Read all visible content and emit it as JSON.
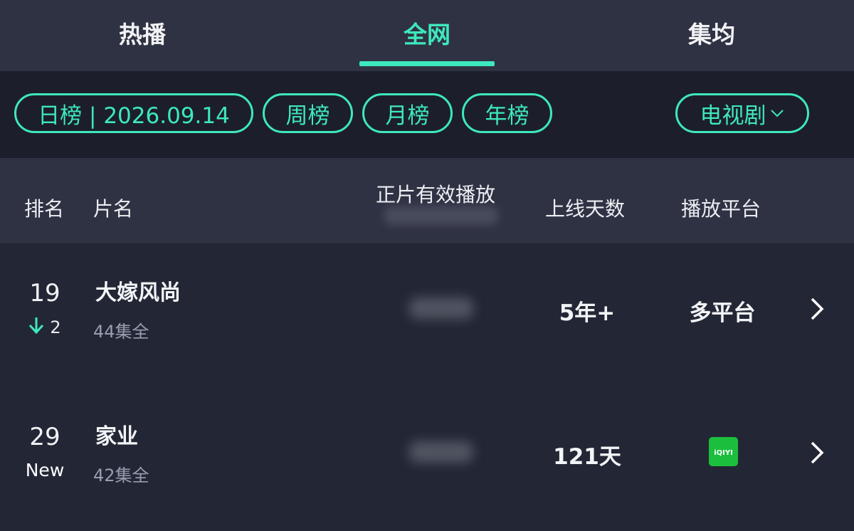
{
  "tabs": [
    {
      "label": "热播",
      "active": false
    },
    {
      "label": "全网",
      "active": true
    },
    {
      "label": "集均",
      "active": false
    }
  ],
  "filters": {
    "daily": "日榜 | 2026.09.14",
    "weekly": "周榜",
    "monthly": "月榜",
    "yearly": "年榜",
    "category": "电视剧"
  },
  "table_header": {
    "rank": "排名",
    "title": "片名",
    "plays": "正片有效播放",
    "days_online": "上线天数",
    "platform": "播放平台"
  },
  "rows": [
    {
      "rank": "19",
      "change": "2",
      "change_icon": "arrow-down-icon",
      "title": "大嫁风尚",
      "episodes": "44集全",
      "days_online": "5年+",
      "platform": "多平台"
    },
    {
      "rank": "29",
      "change": "New",
      "title": "家业",
      "episodes": "42集全",
      "days_online": "121天",
      "platform_logo": "iQIYI",
      "platform_logo_color": "#1bbf3d"
    }
  ],
  "colors": {
    "accent": "#3ee8bd",
    "background": "#232735",
    "header_bg": "#2f3243",
    "filter_bg": "#1c1f2b"
  }
}
